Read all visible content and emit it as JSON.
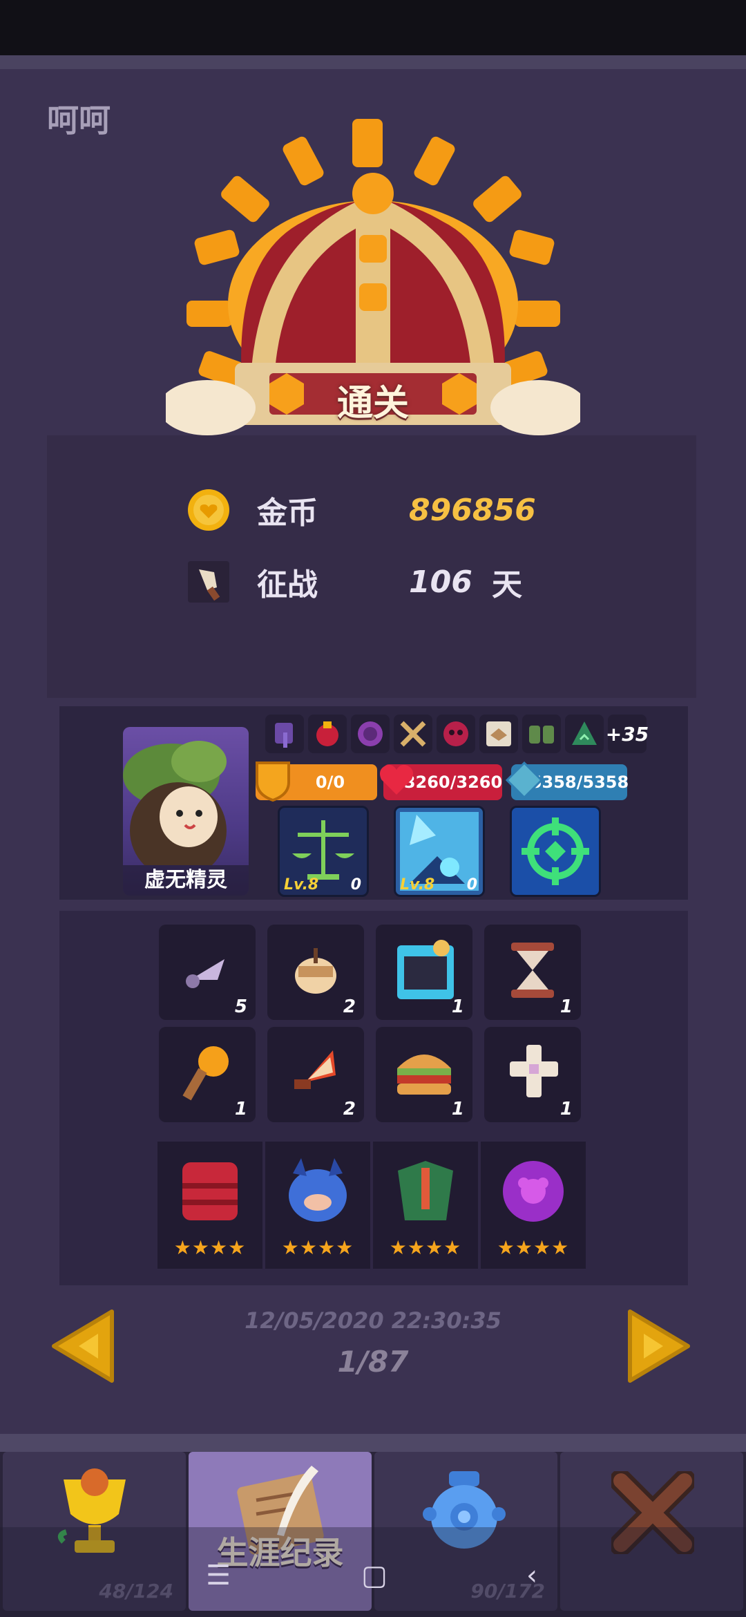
{
  "user": {
    "name": "呵呵"
  },
  "result": {
    "banner": "通关"
  },
  "stats": {
    "gold_label": "金币",
    "gold_value": "896856",
    "campaign_label": "征战",
    "campaign_days": "106",
    "campaign_unit": "天"
  },
  "hero": {
    "name": "虚无精灵",
    "buff_more": "+35",
    "shield": "0/0",
    "hp": "3260/3260",
    "mana": "5358/5358",
    "skills": [
      {
        "lv": "Lv.8",
        "count": "0"
      },
      {
        "lv": "Lv.8",
        "count": "0"
      },
      {
        "lv": "",
        "count": ""
      }
    ]
  },
  "inventory": {
    "items": [
      {
        "name": "knife-icon",
        "count": "5"
      },
      {
        "name": "acorn-icon",
        "count": "2"
      },
      {
        "name": "card-icon",
        "count": "1"
      },
      {
        "name": "hourglass-icon",
        "count": "1"
      },
      {
        "name": "torch-icon",
        "count": "1"
      },
      {
        "name": "blade-icon",
        "count": "2"
      },
      {
        "name": "burger-icon",
        "count": "1"
      },
      {
        "name": "cross-icon",
        "count": "1"
      }
    ],
    "relics": [
      {
        "name": "red-cask-icon",
        "stars": "★★★★"
      },
      {
        "name": "blue-beast-icon",
        "stars": "★★★★"
      },
      {
        "name": "green-armor-icon",
        "stars": "★★★★"
      },
      {
        "name": "purple-orb-icon",
        "stars": "★★★★"
      }
    ]
  },
  "record": {
    "date": "12/05/2020 22:30:35",
    "pager": "1/87"
  },
  "tabs": [
    {
      "name": "trophy",
      "count": "48/124",
      "label": ""
    },
    {
      "name": "career-record",
      "count": "",
      "label": "生涯纪录"
    },
    {
      "name": "vase",
      "count": "90/172",
      "label": ""
    },
    {
      "name": "close",
      "count": "",
      "label": ""
    }
  ],
  "colors": {
    "background": "#3b3251",
    "gold": "#f6c043",
    "active_tab": "#8e7ab9",
    "star": "#f6a51d"
  }
}
